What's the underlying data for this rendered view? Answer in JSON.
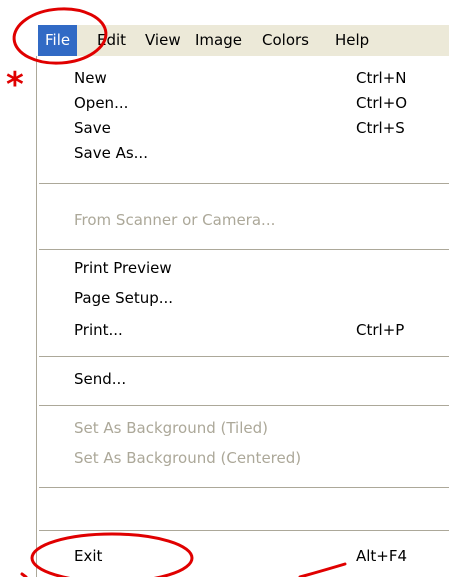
{
  "menubar": {
    "items": [
      {
        "label": "File"
      },
      {
        "label": "Edit"
      },
      {
        "label": "View"
      },
      {
        "label": "Image"
      },
      {
        "label": "Colors"
      },
      {
        "label": "Help"
      }
    ]
  },
  "file_menu": {
    "new": {
      "label": "New",
      "shortcut": "Ctrl+N"
    },
    "open": {
      "label": "Open...",
      "shortcut": "Ctrl+O"
    },
    "save": {
      "label": "Save",
      "shortcut": "Ctrl+S"
    },
    "save_as": {
      "label": "Save As..."
    },
    "from_scanner": {
      "label": "From Scanner or Camera..."
    },
    "print_preview": {
      "label": "Print Preview"
    },
    "page_setup": {
      "label": "Page Setup..."
    },
    "print": {
      "label": "Print...",
      "shortcut": "Ctrl+P"
    },
    "send": {
      "label": "Send..."
    },
    "set_bg_tiled": {
      "label": "Set As Background (Tiled)"
    },
    "set_bg_centered": {
      "label": "Set As Background (Centered)"
    },
    "exit": {
      "label": "Exit",
      "shortcut": "Alt+F4"
    }
  },
  "annotations": {
    "asterisk": "*",
    "color": "#e00000"
  },
  "colors": {
    "menubar_bg": "#ece9d8",
    "highlight": "#316ac5",
    "disabled_text": "#aca899"
  }
}
